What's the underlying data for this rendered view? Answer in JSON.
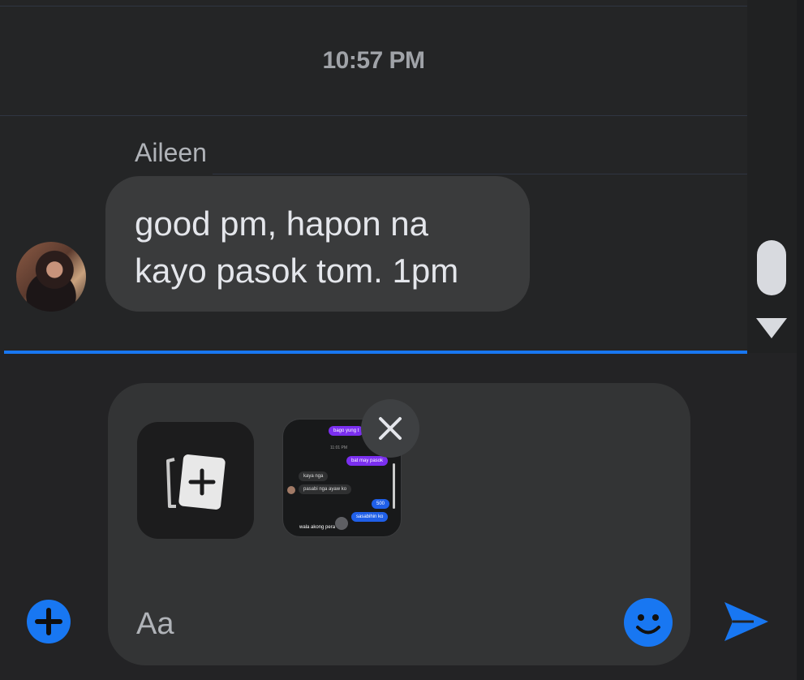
{
  "thread": {
    "timestamp": "10:57 PM",
    "sender_name": "Aileen",
    "message_text": "good pm, hapon na\nkayo pasok tom. 1pm"
  },
  "composer": {
    "placeholder": "Aa",
    "attachment_preview": {
      "messages": [
        {
          "text": "bago yung t",
          "style": "purple"
        },
        {
          "text": "11:01 PM",
          "style": "time"
        },
        {
          "text": "bat may pasok",
          "style": "purple"
        },
        {
          "text": "kaya nga",
          "style": "grey"
        },
        {
          "text": "pasabi nga ayaw ko",
          "style": "grey"
        },
        {
          "text": "500",
          "style": "blue"
        },
        {
          "text": "sasabihin ko",
          "style": "blue"
        },
        {
          "text": "wala akong pera",
          "style": "plain"
        }
      ]
    }
  },
  "icons": {
    "add": "plus-circle-icon",
    "emoji": "smiley-icon",
    "send": "send-arrow-icon",
    "close": "close-icon",
    "add_image": "add-image-icon",
    "scroll_down": "triangle-down-icon"
  },
  "colors": {
    "accent": "#1877f2",
    "bubble": "#3a3b3c",
    "background": "#242526"
  }
}
